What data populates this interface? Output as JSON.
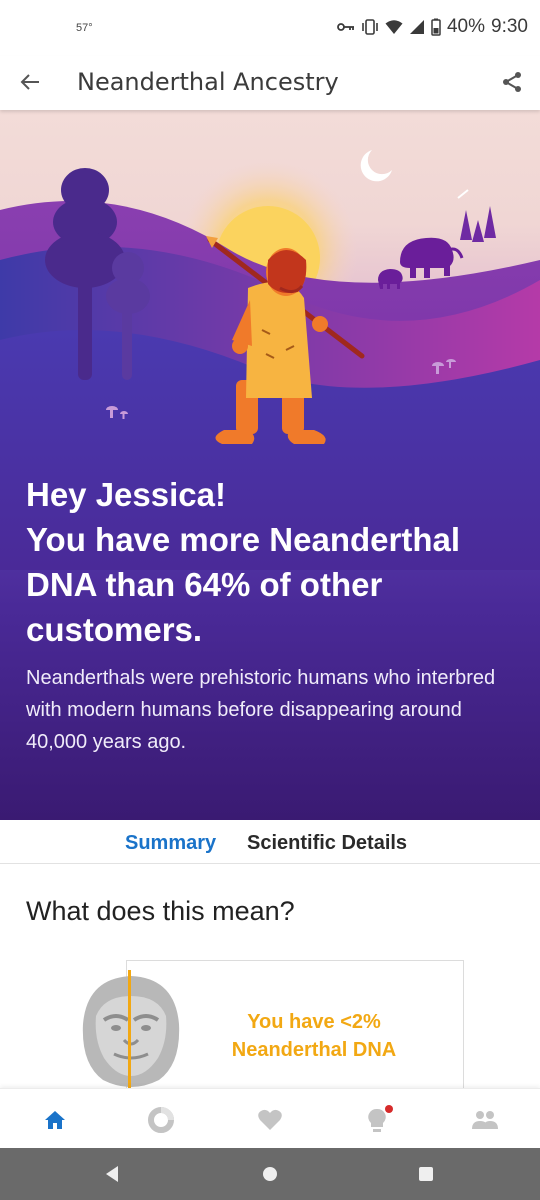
{
  "status_bar": {
    "temperature": "57°",
    "battery": "40%",
    "time": "9:30",
    "icons": [
      "key-icon",
      "vibrate-icon",
      "wifi-icon",
      "signal-icon",
      "battery-icon"
    ]
  },
  "app_bar": {
    "title": "Neanderthal Ancestry",
    "back_icon": "back-arrow-icon",
    "share_icon": "share-icon"
  },
  "hero": {
    "heading_lines": [
      "Hey Jessica!",
      "You have more Neanderthal",
      "DNA than 64% of other",
      "customers."
    ],
    "description": "Neanderthals were prehistoric humans who interbred with modern humans before disappearing around 40,000 years ago."
  },
  "tabs": {
    "summary": "Summary",
    "scientific_details": "Scientific Details",
    "active": "Summary"
  },
  "section": {
    "title": "What does this mean?",
    "card_lines": [
      "You have <2%",
      "Neanderthal DNA"
    ]
  },
  "bottom_nav": {
    "items": [
      "home-icon",
      "ancestry-icon",
      "health-icon",
      "insights-icon",
      "family-icon"
    ],
    "active": "home-icon",
    "notification_on": "insights-icon"
  },
  "colors": {
    "accent_blue": "#1a73c9",
    "highlight_orange": "#f2a813",
    "hero_purple": "#4a2a98",
    "notification_red": "#d62b2b"
  }
}
